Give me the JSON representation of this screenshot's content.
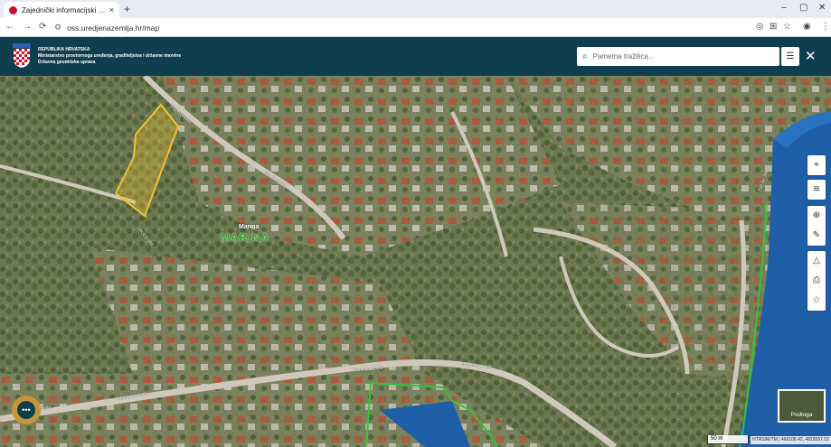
{
  "browser": {
    "tab_title": "Zajednički informacijski sustav",
    "tab_close": "×",
    "new_tab": "+",
    "url": "oss.uredjenazemlja.hr/map",
    "back_icon": "arrow-left-icon",
    "forward_icon": "arrow-right-icon",
    "reload_icon": "reload-icon",
    "minimize": "–",
    "maximize": "▢",
    "close": "✕"
  },
  "header": {
    "org_line1": "REPUBLIKA HRVATSKA",
    "org_line2": "Ministarstvo prostornoga uređenja, graditeljstva i državne imovine",
    "org_line3": "Državna geodetska uprava",
    "search_placeholder": "Pametna tražilica...",
    "filter_icon": "sliders-icon",
    "close_icon": "close-icon"
  },
  "map": {
    "place_label_small": "Marina",
    "place_label_big": "MARINA",
    "streets": [
      "Put Gdinjske",
      "Put Gdinjske",
      "Ulica Kralja",
      "Marinska cesta",
      "Marinska cesta",
      "Marinska cesta",
      "Jadranska cesta",
      "Put Sv. Nikole"
    ],
    "tools": [
      "location-pin-icon",
      "layers-icon",
      "zoom-search-icon",
      "ruler-icon",
      "area-measure-icon",
      "print-icon",
      "star-icon"
    ],
    "basemap_label": "Podloga",
    "scale_label": "50 m",
    "coords": "HTRS96/TM | 466108.42, 4819557.52",
    "colors": {
      "parcel": "#f2c12e",
      "water": "#1f5fa8",
      "boundary": "#35c43a",
      "header": "#0f3e4f"
    }
  }
}
